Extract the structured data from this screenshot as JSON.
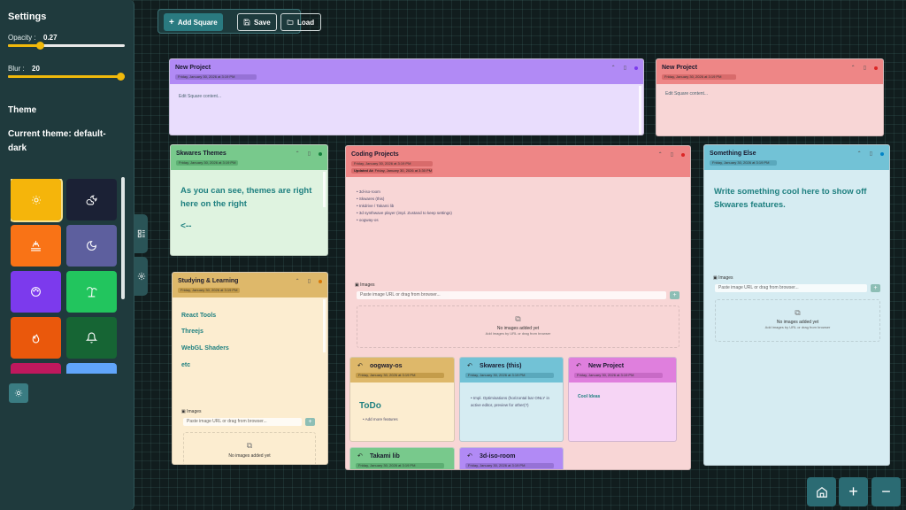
{
  "settings": {
    "title": "Settings",
    "opacity_label": "Opacity :",
    "opacity_value": "0.27",
    "opacity": 0.27,
    "blur_label": "Blur :",
    "blur_value": "20",
    "blur_fraction": 1.0,
    "theme_heading": "Theme",
    "current_theme": "Current theme: default-dark",
    "themes": [
      {
        "icon": "sun-icon",
        "color": "#f5b50b"
      },
      {
        "icon": "cloud-moon-icon",
        "color": "#1b2135"
      },
      {
        "icon": "sunset-icon",
        "color": "#f97316"
      },
      {
        "icon": "moon-icon",
        "color": "#5d5f9e"
      },
      {
        "icon": "palette-icon",
        "color": "#7c3aed"
      },
      {
        "icon": "palm-tree-icon",
        "color": "#22c55e"
      },
      {
        "icon": "flame-icon",
        "color": "#ea580c"
      },
      {
        "icon": "bell-icon",
        "color": "#166534"
      },
      {
        "icon": "theme-icon",
        "color": "#be185d"
      },
      {
        "icon": "theme-icon",
        "color": "#60a5fa"
      }
    ]
  },
  "toolbar": {
    "add_label": "Add Square",
    "save_label": "Save",
    "load_label": "Load"
  },
  "cards": {
    "new_project_1": {
      "title": "New Project",
      "date": "Friday, January 30, 2026 at 3:19 PM",
      "placeholder": "Edit Square content...",
      "bg": "#e9ddfd",
      "head": "#b18af5"
    },
    "new_project_2": {
      "title": "New Project",
      "date": "Friday, January 30, 2026 at 3:19 PM",
      "placeholder": "Edit Square content...",
      "bg": "#f8d6d6",
      "head": "#ee8686"
    },
    "themes": {
      "title": "Skwares Themes",
      "date": "Friday, January 30, 2026 at 3:19 PM",
      "text": "As you can see, themes are right here on the right",
      "arrow": "<--",
      "bg": "#dff3e0",
      "head": "#78c98c"
    },
    "studying": {
      "title": "Studying & Learning",
      "date": "Friday, January 30, 2026 at 3:19 PM",
      "items": [
        "React Tools",
        "Threejs",
        "WebGL Shaders",
        "etc"
      ],
      "images_label": "Images",
      "url_placeholder": "Paste image URL or drag from browser...",
      "no_images": "No images added yet",
      "bg": "#fcedd0",
      "head": "#deb86a"
    },
    "coding": {
      "title": "Coding Projects",
      "date": "Friday, January 30, 2026 at 3:19 PM",
      "updated_label": "Updated At:",
      "updated": "Friday, January 30, 2026 at 3:30 PM",
      "items": [
        "3d-iso-room",
        "Skwares (this)",
        "Inkdrive / Takami lib",
        "3d synthwave player (impl. Zustand to keep settings)",
        "oogway-os"
      ],
      "images_label": "Images",
      "url_placeholder": "Paste image URL or drag from browser...",
      "no_images": "No images added yet",
      "no_images_sub": "Add images by URL or drag from browser",
      "bg": "#f8d6d6",
      "head": "#ee8686"
    },
    "something": {
      "title": "Something Else",
      "date": "Friday, January 30, 2026 at 3:19 PM",
      "text": "Write something cool here to show off Skwares features.",
      "images_label": "Images",
      "url_placeholder": "Paste image URL or drag from browser...",
      "no_images": "No images added yet",
      "no_images_sub": "Add images by URL or drag from browser",
      "bg": "#d6ecf2",
      "head": "#72c2d6"
    }
  },
  "subcards": {
    "oogway": {
      "title": "oogway-os",
      "date": "Friday, January 30, 2026 at 3:19 PM",
      "heading": "ToDo",
      "items": [
        "Add more features"
      ],
      "bg": "#fcedd0",
      "head": "#deb86a"
    },
    "skwares": {
      "title": "Skwares (this)",
      "date": "Friday, January 30, 2026 at 3:19 PM",
      "items": [
        "Impl. Optimisations (horizontal bar ONLY in active editor, preview for other(?)"
      ],
      "bg": "#d6ecf2",
      "head": "#72c2d6"
    },
    "newproj": {
      "title": "New Project",
      "date": "Friday, January 30, 2026 at 3:19 PM",
      "text": "Cool Ideas",
      "bg": "#f6d5f5",
      "head": "#df7fdd"
    },
    "takami": {
      "title": "Takami lib",
      "date": "Friday, January 30, 2026 at 3:19 PM",
      "bg": "#dff3e0",
      "head": "#78c98c"
    },
    "iso": {
      "title": "3d-iso-room",
      "date": "Friday, January 30, 2026 at 3:19 PM",
      "bg": "#e9ddfd",
      "head": "#b18af5"
    }
  },
  "nav": {
    "home_icon": "home-icon",
    "zoom_in_icon": "plus-icon",
    "zoom_out_icon": "minus-icon"
  }
}
